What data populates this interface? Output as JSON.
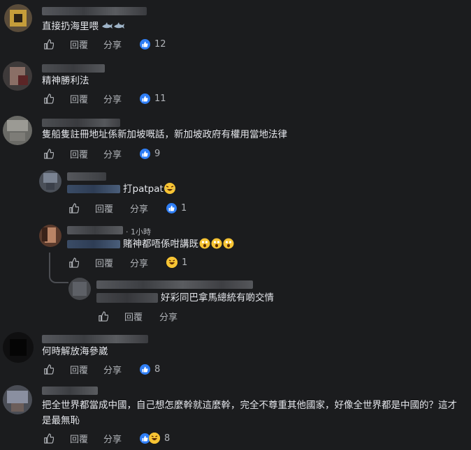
{
  "actions": {
    "reply": "回覆",
    "share": "分享"
  },
  "comments": [
    {
      "text": "直接扔海里喂",
      "count": "12"
    },
    {
      "text": "精神勝利法",
      "count": "11"
    },
    {
      "text": "隻船隻註冊地址係新加坡嘅話，新加坡政府有權用當地法律",
      "count": "9"
    },
    {
      "text": "打patpat",
      "count": "1"
    },
    {
      "text": "賭神都唔係咁講既",
      "time": "· 1小時",
      "count": "1"
    },
    {
      "text": "好彩同巴拿馬總統有啲交情"
    },
    {
      "text": "何時解放海參崴",
      "count": "8"
    },
    {
      "text": "把全世界都當成中國，自己想怎麼幹就這麼幹，完全不尊重其他國家，好像全世界都是中國的？這才是最無恥",
      "count": "8"
    }
  ],
  "icons": {
    "like": "thumbs-up-icon",
    "like_reaction": "like-reaction-icon",
    "haha_reaction": "haha-reaction-icon",
    "shark": "shark-emoji-icon",
    "tears": "tears-of-joy-emoji-icon",
    "shocked": "shocked-emoji-icon"
  },
  "colors": {
    "background": "#1b1c1e",
    "text": "#e4e6eb",
    "muted": "#b0b3b8",
    "like_blue": "#2f7ef5"
  }
}
